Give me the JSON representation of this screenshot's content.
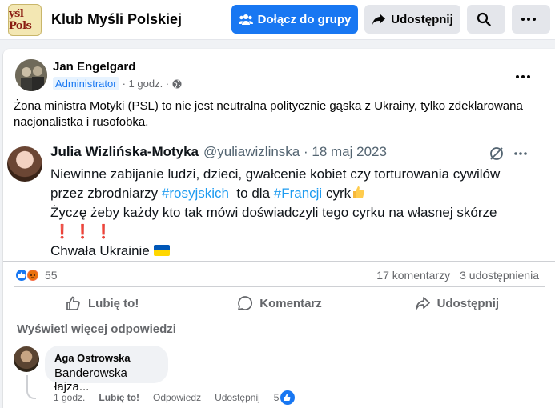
{
  "header": {
    "group_thumb_text": "yśl Pols",
    "group_name": "Klub Myśli Polskiej",
    "join_label": "Dołącz do grupy",
    "share_label": "Udostępnij",
    "accent": "#1877f2"
  },
  "post": {
    "author": "Jan Engelgard",
    "badge": "Administrator",
    "time": "1 godz.",
    "privacy_icon": "globe-icon",
    "text": "Żona ministra Motyki (PSL) to nie jest neutralna politycznie gąska z Ukrainy, tylko zdeklarowana nacjonalistka i rusofobka."
  },
  "tweet": {
    "name": "Julia Wizlińska-Motyka",
    "handle": "@yuliawizlinska · 18 maj 2023",
    "line1": "Niewinne zabijanie ludzi, dzieci, gwałcenie kobiet czy torturowania cywilów",
    "line2_a": "przez zbrodniarzy ",
    "hashtag1": "#rosyjskich",
    "line2_b": "  to dla ",
    "hashtag2": "#Francji",
    "line2_c": " cyrk",
    "line3": "Życzę żeby każdy kto tak mówi doświadczyli tego cyrku na własnej skórze",
    "exclaims": "❗ ❗ ❗",
    "line5": "Chwała Ukrainie"
  },
  "stats": {
    "reactions_count": "55",
    "comments": "17 komentarzy",
    "shares": "3 udostępnienia"
  },
  "actions": {
    "like": "Lubię to!",
    "comment": "Komentarz",
    "share": "Udostępnij"
  },
  "comments": {
    "more_label": "Wyświetl więcej odpowiedzi",
    "items": [
      {
        "author": "Aga Ostrowska",
        "text": "Banderowska łajza...",
        "time": "1 godz.",
        "like": "Lubię to!",
        "reply": "Odpowiedz",
        "share": "Udostępnij",
        "likes": "5"
      }
    ]
  }
}
